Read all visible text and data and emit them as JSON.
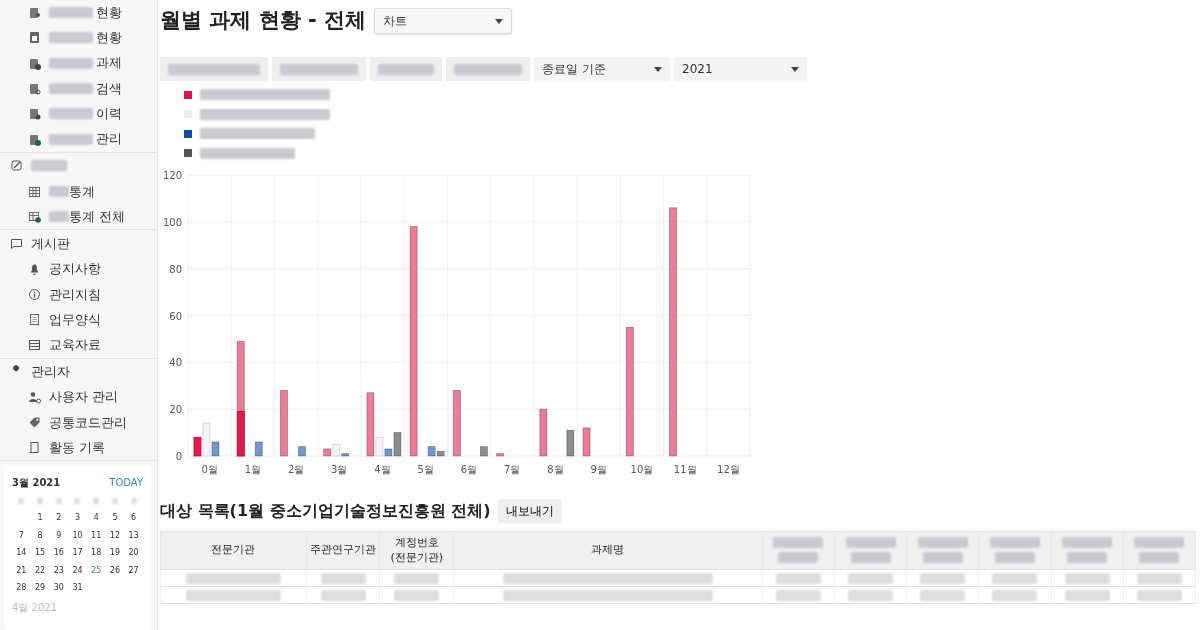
{
  "sidebar": {
    "sections": [
      {
        "items": [
          {
            "redacted": true,
            "label": "현황"
          },
          {
            "redacted": true,
            "label": "현황"
          },
          {
            "redacted": true,
            "label": "과제"
          },
          {
            "redacted": true,
            "label": "검색"
          },
          {
            "redacted": true,
            "label": "이력"
          },
          {
            "redacted": true,
            "label": "관리"
          }
        ]
      },
      {
        "redacted": true,
        "items": [
          {
            "redacted": true,
            "label": "통계"
          },
          {
            "redacted": true,
            "label": "통계 전체"
          }
        ]
      },
      {
        "label": "게시판",
        "items": [
          {
            "label": "공지사항"
          },
          {
            "label": "관리지침"
          },
          {
            "label": "업무양식"
          },
          {
            "label": "교육자료"
          }
        ]
      },
      {
        "label": "관리자",
        "items": [
          {
            "label": "사용자 관리"
          },
          {
            "label": "공통코드관리"
          },
          {
            "label": "활동 기록"
          }
        ]
      }
    ]
  },
  "calendar": {
    "month": "3월 2021",
    "today_label": "TODAY",
    "days": [
      {
        "label": "1",
        "selected": false
      },
      {
        "label": "2",
        "selected": false
      },
      {
        "label": "3",
        "selected": false
      },
      {
        "label": "4",
        "selected": false
      },
      {
        "label": "5",
        "selected": false
      },
      {
        "label": "6",
        "selected": false
      },
      {
        "label": "7",
        "selected": false
      },
      {
        "label": "8",
        "selected": false
      },
      {
        "label": "9",
        "selected": false
      },
      {
        "label": "10",
        "selected": false
      },
      {
        "label": "11",
        "selected": false
      },
      {
        "label": "12",
        "selected": false
      },
      {
        "label": "13",
        "selected": false
      },
      {
        "label": "14",
        "selected": false
      },
      {
        "label": "15",
        "selected": false
      },
      {
        "label": "16",
        "selected": false
      },
      {
        "label": "17",
        "selected": false
      },
      {
        "label": "18",
        "selected": false
      },
      {
        "label": "19",
        "selected": false
      },
      {
        "label": "20",
        "selected": false
      },
      {
        "label": "21",
        "selected": false
      },
      {
        "label": "22",
        "selected": false
      },
      {
        "label": "23",
        "selected": false
      },
      {
        "label": "24",
        "selected": false
      },
      {
        "label": "25",
        "selected": true
      },
      {
        "label": "26",
        "selected": false
      },
      {
        "label": "27",
        "selected": false
      },
      {
        "label": "28",
        "selected": false
      },
      {
        "label": "29",
        "selected": false
      },
      {
        "label": "30",
        "selected": false
      },
      {
        "label": "31",
        "selected": false
      }
    ],
    "next_month": "4월 2021"
  },
  "header": {
    "title": "월별 과제 현황 - 전체",
    "view_select": "차트"
  },
  "filters": {
    "buttons": [
      {
        "redacted": true
      },
      {
        "redacted": true
      },
      {
        "redacted": true
      },
      {
        "redacted": true
      }
    ],
    "date_basis": "종료일 기준",
    "year": "2021"
  },
  "legend": [
    {
      "color": "#e0114a",
      "redacted": true
    },
    {
      "color": "#ececf0",
      "redacted": true
    },
    {
      "color": "#0d4fa0",
      "redacted": true
    },
    {
      "color": "#555555",
      "redacted": true
    }
  ],
  "chart_data": {
    "type": "bar",
    "categories": [
      "0월",
      "1월",
      "2월",
      "3월",
      "4월",
      "5월",
      "6월",
      "7월",
      "8월",
      "9월",
      "10월",
      "11월",
      "12월"
    ],
    "ylim": [
      0,
      120
    ],
    "yticks": [
      0,
      20,
      40,
      60,
      80,
      100,
      120
    ],
    "grid": true,
    "series": [
      {
        "color": "#f07a98",
        "values": [
          null,
          49,
          28,
          3,
          27,
          98,
          28,
          1,
          20,
          12,
          55,
          106,
          null
        ]
      },
      {
        "color": "#f4f4f7",
        "values": [
          14,
          null,
          null,
          5,
          8,
          null,
          null,
          null,
          null,
          null,
          null,
          null,
          null
        ]
      },
      {
        "color": "#6b9bd0",
        "values": [
          6,
          6,
          4,
          1,
          3,
          4,
          null,
          null,
          null,
          null,
          null,
          null,
          null
        ]
      },
      {
        "color": "#8e8e8e",
        "values": [
          null,
          null,
          null,
          null,
          10,
          2,
          4,
          null,
          11,
          null,
          null,
          null,
          null
        ]
      },
      {
        "color": "#e8174a",
        "values": [
          8,
          19,
          null,
          null,
          null,
          null,
          null,
          null,
          null,
          null,
          null,
          null,
          null
        ]
      }
    ]
  },
  "list": {
    "title": "대상 목록(1월 중소기업기술정보진흥원 전체)",
    "export_button": "내보내기",
    "columns": [
      {
        "label": "전문기관"
      },
      {
        "label": "주관연구기관"
      },
      {
        "label": "계정번호\n(전문기관)"
      },
      {
        "label": "과제명"
      },
      {
        "redacted": true
      },
      {
        "redacted": true
      },
      {
        "redacted": true
      },
      {
        "redacted": true
      },
      {
        "redacted": true
      },
      {
        "redacted": true
      }
    ],
    "rows": [
      {
        "redacted": true
      },
      {
        "redacted": true
      }
    ]
  }
}
